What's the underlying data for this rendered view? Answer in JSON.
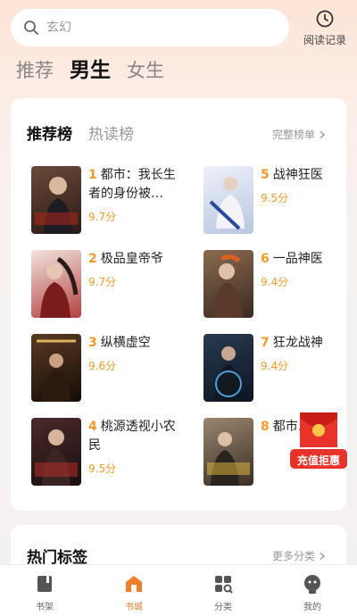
{
  "search": {
    "placeholder": "玄幻"
  },
  "history": {
    "label": "阅读记录"
  },
  "channels": [
    {
      "label": "推荐"
    },
    {
      "label": "男生",
      "active": true
    },
    {
      "label": "女生"
    }
  ],
  "ranking": {
    "tabs": [
      {
        "label": "推荐榜",
        "active": true
      },
      {
        "label": "热读榜"
      }
    ],
    "more_label": "完整榜单",
    "books": [
      {
        "rank": "1",
        "title": "都市：我长生者的身份被…",
        "score": "9.7分",
        "cover_color": "#4a2f2a"
      },
      {
        "rank": "2",
        "title": "极品皇帝爷",
        "score": "9.7分",
        "cover_color": "#8a2f2f"
      },
      {
        "rank": "3",
        "title": "纵横虚空",
        "score": "9.6分",
        "cover_color": "#3a2418"
      },
      {
        "rank": "4",
        "title": "桃源透视小农民",
        "score": "9.5分",
        "cover_color": "#3b1f1f"
      },
      {
        "rank": "5",
        "title": "战神狂医",
        "score": "9.5分",
        "cover_color": "#cfd8ea"
      },
      {
        "rank": "6",
        "title": "一品神医",
        "score": "9.4分",
        "cover_color": "#5a3a2a"
      },
      {
        "rank": "7",
        "title": "狂龙战神",
        "score": "9.4分",
        "cover_color": "#1f2a3a"
      },
      {
        "rank": "8",
        "title": "都市…",
        "score": "",
        "cover_color": "#5a4a3a"
      }
    ]
  },
  "hot_tags": {
    "title": "热门标签",
    "more_label": "更多分类"
  },
  "packet": {
    "label": "充值拒惠"
  },
  "nav": [
    {
      "label": "书架",
      "icon": "bookshelf-icon"
    },
    {
      "label": "书城",
      "icon": "store-icon",
      "active": true
    },
    {
      "label": "分类",
      "icon": "category-icon"
    },
    {
      "label": "我的",
      "icon": "profile-icon"
    }
  ],
  "colors": {
    "accent": "#f07f2a",
    "score": "#f39a2b"
  }
}
